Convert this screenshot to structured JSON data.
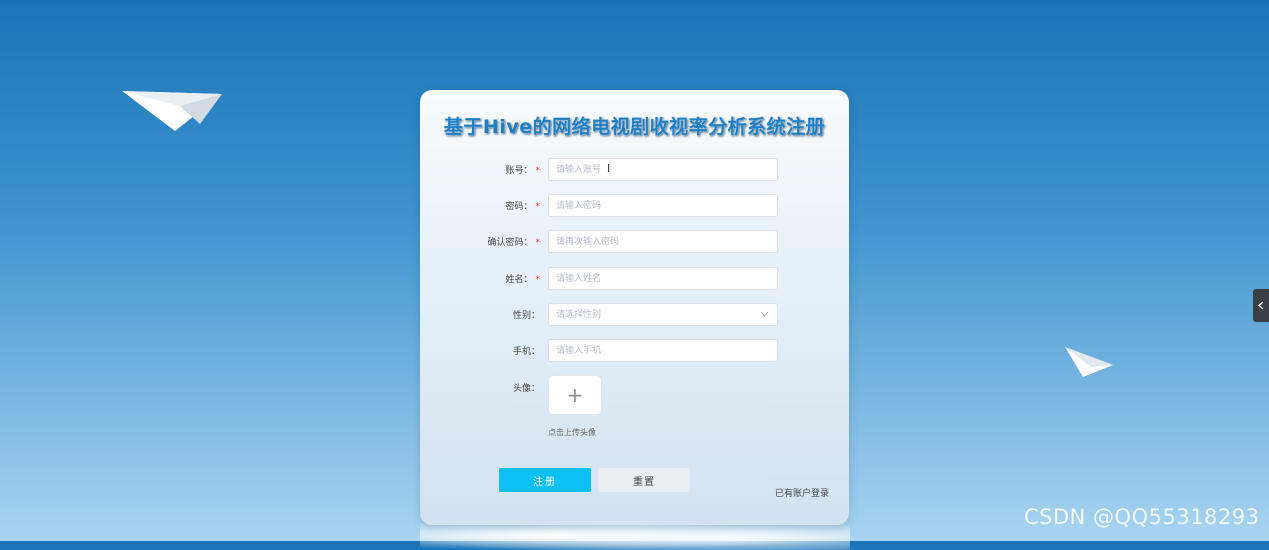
{
  "title": "基于Hive的网络电视剧收视率分析系统注册",
  "form": {
    "account": {
      "label": "账号：",
      "required": true,
      "placeholder": "请输入账号"
    },
    "password": {
      "label": "密码：",
      "required": true,
      "placeholder": "请输入密码"
    },
    "confirm_password": {
      "label": "确认密码：",
      "required": true,
      "placeholder": "请再次输入密码"
    },
    "name": {
      "label": "姓名：",
      "required": true,
      "placeholder": "请输入姓名"
    },
    "gender": {
      "label": "性别：",
      "required": false,
      "placeholder": "请选择性别"
    },
    "phone": {
      "label": "手机：",
      "required": false,
      "placeholder": "请输入手机"
    },
    "avatar": {
      "label": "头像：",
      "hint": "点击上传头像",
      "upload_glyph": "+"
    }
  },
  "required_mark": "*",
  "buttons": {
    "register": "注册",
    "reset": "重置"
  },
  "login_link": "已有账户登录",
  "watermark": "CSDN @QQ55318293",
  "colors": {
    "primary": "#0ac0f5",
    "title": "#1f7fc4",
    "required": "#e53935"
  }
}
